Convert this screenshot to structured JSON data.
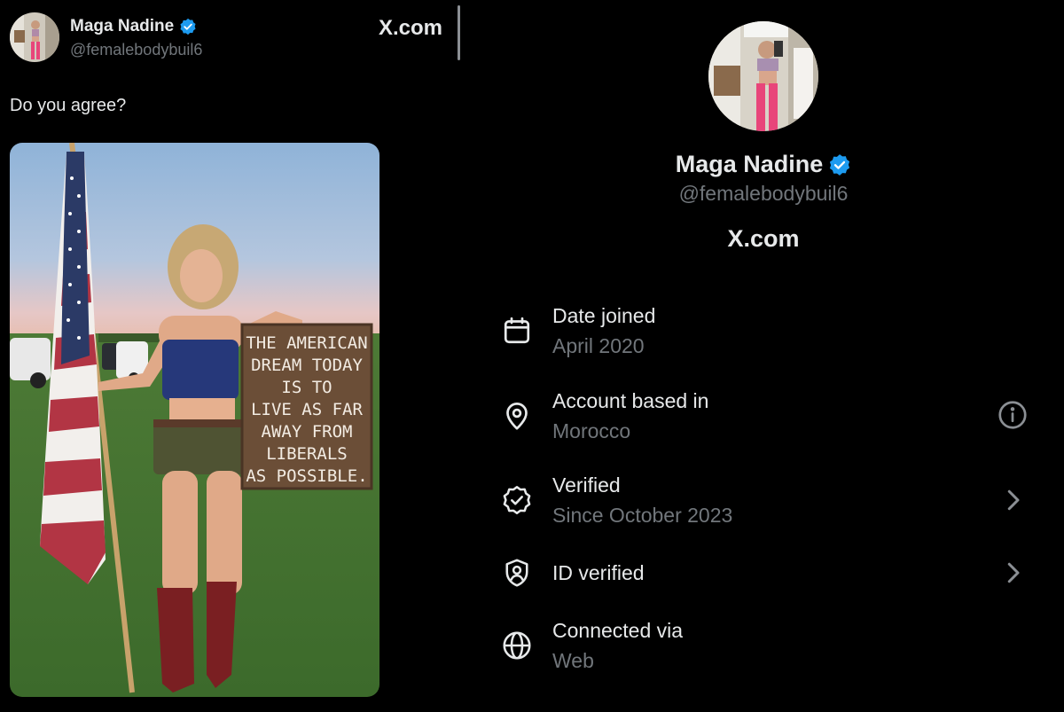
{
  "tweet": {
    "author_name": "Maga Nadine",
    "author_handle": "@femalebodybuil6",
    "source_label": "X.com",
    "text": "Do you agree?",
    "photo": {
      "sign_lines": [
        "THE AMERICAN",
        "DREAM TODAY",
        "IS TO",
        "LIVE AS FAR",
        "AWAY FROM",
        "LIBERALS",
        "AS POSSIBLE."
      ]
    }
  },
  "profile": {
    "name": "Maga Nadine",
    "handle": "@femalebodybuil6",
    "source_label": "X.com"
  },
  "about": {
    "rows": [
      {
        "title": "Date joined",
        "value": "April 2020",
        "icon": "calendar-icon"
      },
      {
        "title": "Account based in",
        "value": "Morocco",
        "icon": "location-pin-icon",
        "aux_icon": "info-icon"
      },
      {
        "title": "Verified",
        "value": "Since October 2023",
        "icon": "verified-badge-icon",
        "aux_icon": "chevron-right-icon"
      },
      {
        "title": "ID verified",
        "icon": "shield-id-icon",
        "aux_icon": "chevron-right-icon"
      },
      {
        "title": "Connected via",
        "value": "Web",
        "icon": "globe-icon"
      }
    ]
  },
  "colors": {
    "background": "#000000",
    "text_primary": "#e7e9ea",
    "text_secondary": "#71767b",
    "verified_blue": "#1d9bf0"
  }
}
